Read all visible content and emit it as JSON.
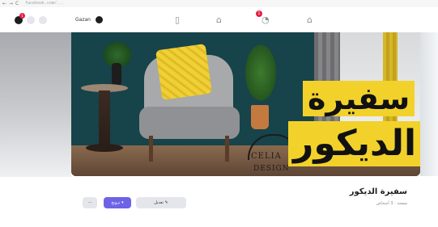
{
  "browser": {
    "nav_glyphs": [
      "←",
      "→",
      "C"
    ],
    "url": "facebook.com/..."
  },
  "topbar": {
    "left_badge": "1",
    "profile_chip_label": "Gazan",
    "nav_badge": "1",
    "icons": [
      "messenger-icon",
      "grid-menu-icon",
      "avatar-icon",
      "home-icon",
      "marketplace-icon",
      "notifications-icon",
      "flag-icon"
    ]
  },
  "cover": {
    "arabic_title_top": "سفيرة",
    "arabic_title_bottom": "الديكور",
    "logo_line1": "CELIA",
    "logo_line2": "DESIGN"
  },
  "page": {
    "name": "سفيرة الديكور",
    "meta": "صفحة · 3 أشخاص"
  },
  "actions": {
    "more_label": "···",
    "blue_label": "ترويج ▾",
    "grey_label": "تعديل ✎"
  },
  "colors": {
    "accent": "#6e63e6",
    "badge": "#e41e3f",
    "title_yellow": "#f2d22a"
  }
}
